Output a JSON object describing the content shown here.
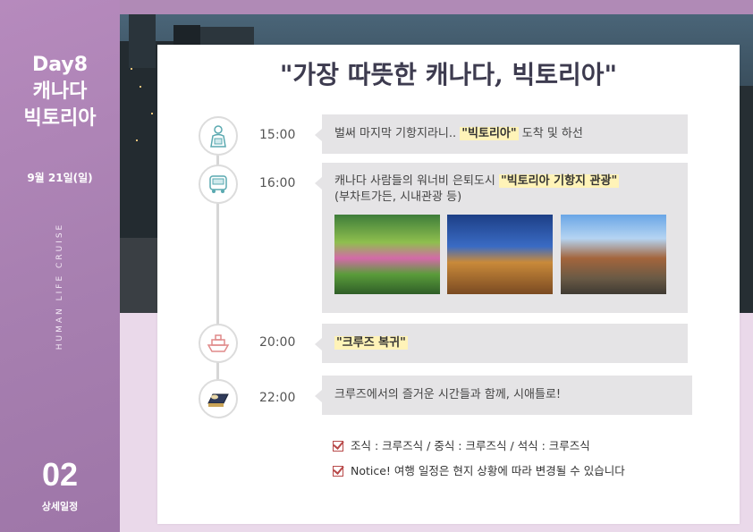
{
  "sidebar": {
    "day": "Day8",
    "city_line1": "캐나다",
    "city_line2": "빅토리아",
    "date": "9월 21일(일)",
    "vertical_text": "HUMAN LIFE CRUISE",
    "section_number": "02",
    "section_label": "상세일정"
  },
  "title": "\"가장 따뜻한 캐나다, 빅토리아\"",
  "timeline": [
    {
      "time": "15:00",
      "icon": "person-with-bag-icon",
      "pre": "벌써 마지막 기항지라니.. ",
      "highlight": "\"빅토리아\"",
      "post": " 도착 및 하선"
    },
    {
      "time": "16:00",
      "icon": "bus-icon",
      "pre": "캐나다 사람들의 워너비 은퇴도시 ",
      "highlight": "\"빅토리아 기항지 관광\"",
      "line2": "(부차트가든, 시내관광 등)"
    },
    {
      "time": "20:00",
      "icon": "cruise-ship-icon",
      "highlight": "\"크루즈 복귀\""
    },
    {
      "time": "22:00",
      "icon": "bed-icon",
      "text": "크루즈에서의 즐거운 시간들과 함께, 시애틀로!"
    }
  ],
  "notes": {
    "meals": "조식 : 크루즈식   /   중식 : 크루즈식   /   석식 : 크루즈식",
    "notice": "Notice!  여행 일정은 현지 상황에 따라 변경될 수 있습니다"
  },
  "colors": {
    "sidebar": "#a77fb0",
    "highlight": "#fff3b8",
    "box": "#e5e4e6",
    "check": "#b84a4a"
  }
}
